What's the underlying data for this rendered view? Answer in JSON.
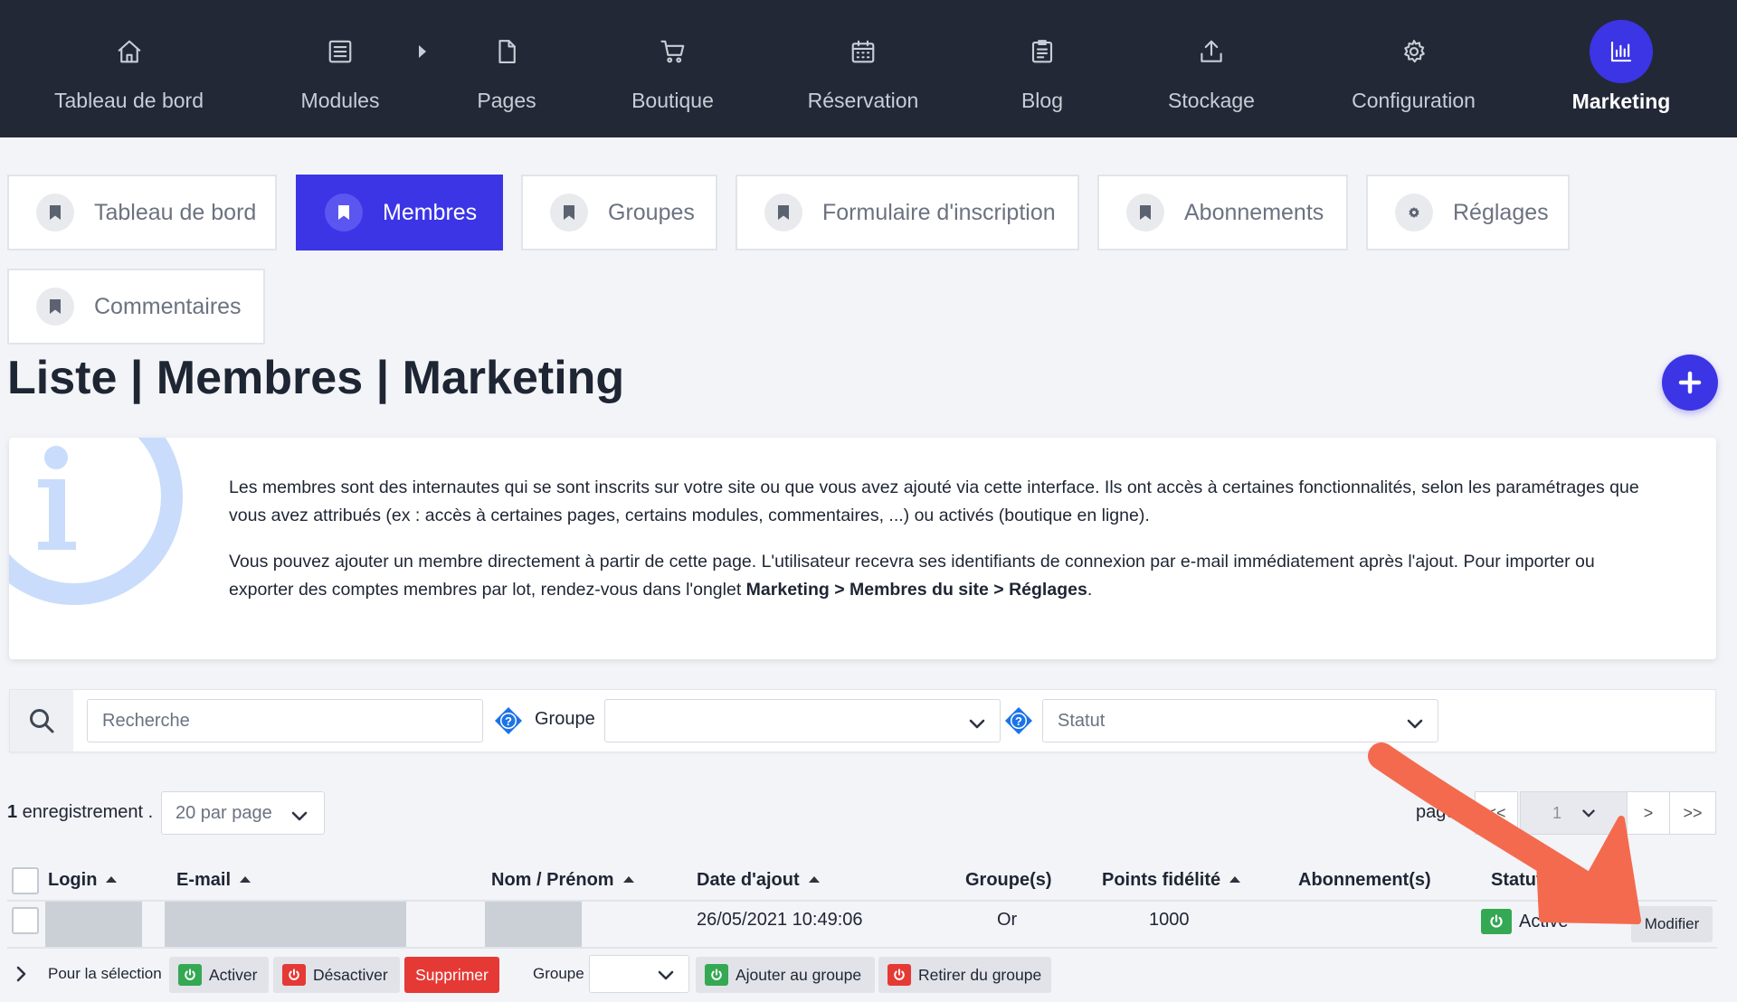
{
  "topnav": {
    "items": [
      {
        "label": "Tableau de bord",
        "icon": "home-icon"
      },
      {
        "label": "Modules",
        "icon": "list-icon"
      },
      {
        "label": "Pages",
        "icon": "file-icon"
      },
      {
        "label": "Boutique",
        "icon": "cart-icon"
      },
      {
        "label": "Réservation",
        "icon": "calendar-icon"
      },
      {
        "label": "Blog",
        "icon": "clipboard-icon"
      },
      {
        "label": "Stockage",
        "icon": "upload-icon"
      },
      {
        "label": "Configuration",
        "icon": "gear-icon"
      },
      {
        "label": "Marketing",
        "icon": "bar-chart-icon",
        "active": true
      }
    ]
  },
  "subtabs": [
    {
      "label": "Tableau de bord",
      "icon": "bookmark-icon"
    },
    {
      "label": "Membres",
      "icon": "bookmark-icon",
      "active": true
    },
    {
      "label": "Groupes",
      "icon": "bookmark-icon"
    },
    {
      "label": "Formulaire d'inscription",
      "icon": "bookmark-icon"
    },
    {
      "label": "Abonnements",
      "icon": "bookmark-icon"
    },
    {
      "label": "Réglages",
      "icon": "gear-icon"
    },
    {
      "label": "Commentaires",
      "icon": "bookmark-icon"
    }
  ],
  "page_title": "Liste | Membres | Marketing",
  "info": {
    "p1": "Les membres sont des internautes qui se sont inscrits sur votre site ou que vous avez ajouté via cette interface. Ils ont accès à certaines fonctionnalités, selon les paramétrages que vous avez attribués (ex : accès à certaines pages, certains modules, commentaires, ...) ou activés (boutique en ligne).",
    "p2_text": "Vous pouvez ajouter un membre directement à partir de cette page. L'utilisateur recevra ses identifiants de connexion par e-mail immédiatement après l'ajout. Pour importer ou exporter des comptes membres par lot, rendez-vous dans l'onglet ",
    "p2_bold": "Marketing > Membres du site > Réglages",
    "p2_end": "."
  },
  "filters": {
    "search_placeholder": "Recherche",
    "group_label": "Groupe",
    "group_value": "",
    "status_placeholder": "Statut"
  },
  "listing": {
    "count": "1",
    "count_label": " enregistrement .",
    "per_page": "20 par page",
    "pager_label": "page",
    "pager_first": "<<",
    "pager_current": "1",
    "pager_next": ">",
    "pager_last": ">>"
  },
  "table": {
    "headers": {
      "login": "Login",
      "email": "E-mail",
      "name": "Nom / Prénom",
      "date": "Date d'ajout",
      "groups": "Groupe(s)",
      "points": "Points fidélité",
      "subscriptions": "Abonnement(s)",
      "status": "Statut"
    },
    "rows": [
      {
        "date": "26/05/2021 10:49:06",
        "group": "Or",
        "points": "1000",
        "subscriptions": "",
        "status": "Active",
        "action": "Modifier"
      }
    ]
  },
  "bulk": {
    "label": "Pour la sélection",
    "activate": "Activer",
    "deactivate": "Désactiver",
    "delete": "Supprimer",
    "group_label": "Groupe",
    "add_to_group": "Ajouter au groupe",
    "remove_from_group": "Retirer du groupe"
  },
  "colors": {
    "nav_bg": "#222836",
    "accent": "#3b35e6",
    "success": "#34a853",
    "danger": "#e53935",
    "annotation": "#f46a4e"
  }
}
